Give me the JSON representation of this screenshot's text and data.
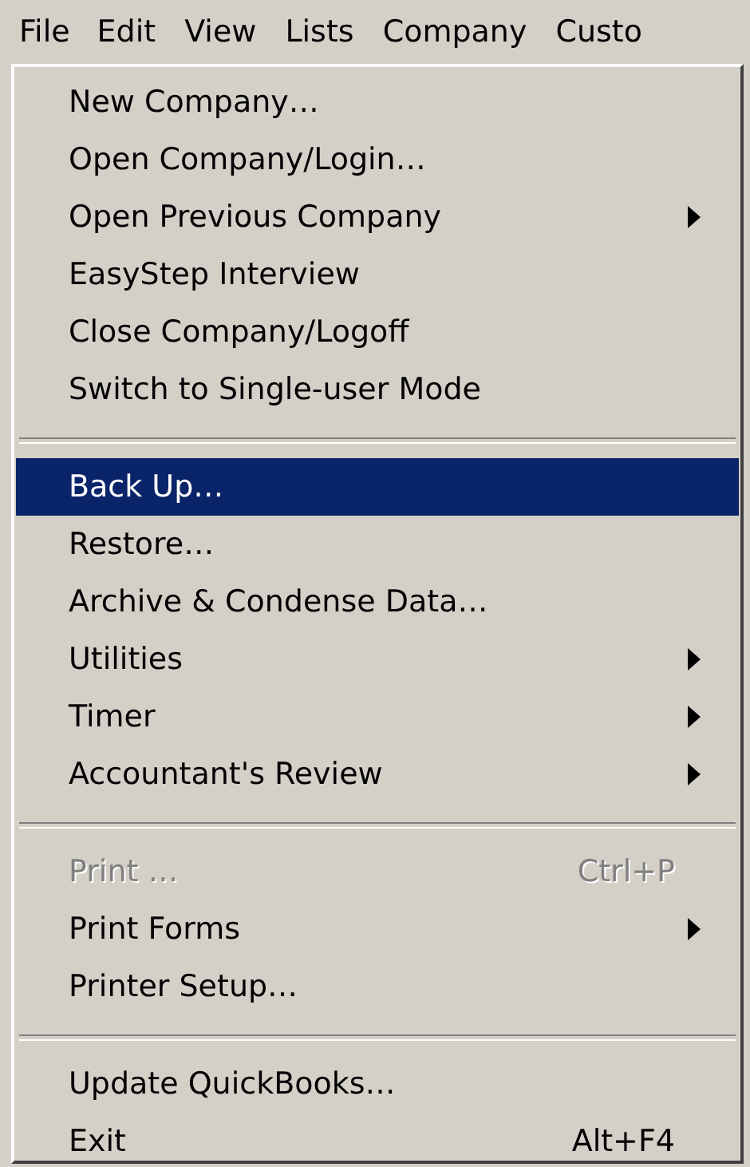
{
  "menubar": [
    {
      "label": "File",
      "selected": true
    },
    {
      "label": "Edit",
      "selected": false
    },
    {
      "label": "View",
      "selected": false
    },
    {
      "label": "Lists",
      "selected": false
    },
    {
      "label": "Company",
      "selected": false
    },
    {
      "label": "Custo",
      "selected": false
    }
  ],
  "menu": {
    "sections": [
      {
        "items": [
          {
            "label": "New Company…",
            "submenu": false,
            "disabled": false,
            "selected": false
          },
          {
            "label": "Open Company/Login…",
            "submenu": false,
            "disabled": false,
            "selected": false
          },
          {
            "label": "Open Previous Company",
            "submenu": true,
            "disabled": false,
            "selected": false
          },
          {
            "label": "EasyStep Interview",
            "submenu": false,
            "disabled": false,
            "selected": false
          },
          {
            "label": "Close Company/Logoff",
            "submenu": false,
            "disabled": false,
            "selected": false
          },
          {
            "label": "Switch to Single-user Mode",
            "submenu": false,
            "disabled": false,
            "selected": false
          }
        ]
      },
      {
        "items": [
          {
            "label": "Back Up…",
            "submenu": false,
            "disabled": false,
            "selected": true
          },
          {
            "label": "Restore…",
            "submenu": false,
            "disabled": false,
            "selected": false
          },
          {
            "label": "Archive & Condense Data…",
            "submenu": false,
            "disabled": false,
            "selected": false
          },
          {
            "label": "Utilities",
            "submenu": true,
            "disabled": false,
            "selected": false
          },
          {
            "label": "Timer",
            "submenu": true,
            "disabled": false,
            "selected": false
          },
          {
            "label": "Accountant's Review",
            "submenu": true,
            "disabled": false,
            "selected": false
          }
        ]
      },
      {
        "items": [
          {
            "label": "Print …",
            "shortcut": "Ctrl+P",
            "submenu": false,
            "disabled": true,
            "selected": false
          },
          {
            "label": "Print Forms",
            "submenu": true,
            "disabled": false,
            "selected": false
          },
          {
            "label": "Printer Setup…",
            "submenu": false,
            "disabled": false,
            "selected": false
          }
        ]
      },
      {
        "items": [
          {
            "label": "Update QuickBooks…",
            "submenu": false,
            "disabled": false,
            "selected": false
          },
          {
            "label": "Exit",
            "shortcut": "Alt+F4",
            "submenu": false,
            "disabled": false,
            "selected": false
          }
        ]
      }
    ]
  }
}
